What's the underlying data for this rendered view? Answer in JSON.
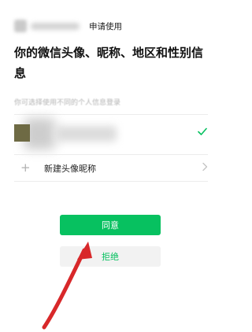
{
  "header": {
    "request_text": "申请使用"
  },
  "title": "你的微信头像、昵称、地区和性别信息",
  "hint": "你可选择使用不同的个人信息登录",
  "profile_option": {
    "selected": true
  },
  "new_profile": {
    "label": "新建头像昵称"
  },
  "buttons": {
    "agree": "同意",
    "reject": "拒绝"
  },
  "colors": {
    "accent": "#07c160",
    "annotation_arrow": "#d8282a"
  },
  "icons": {
    "check": "check-icon",
    "plus": "plus-icon",
    "chevron": "chevron-right-icon"
  }
}
